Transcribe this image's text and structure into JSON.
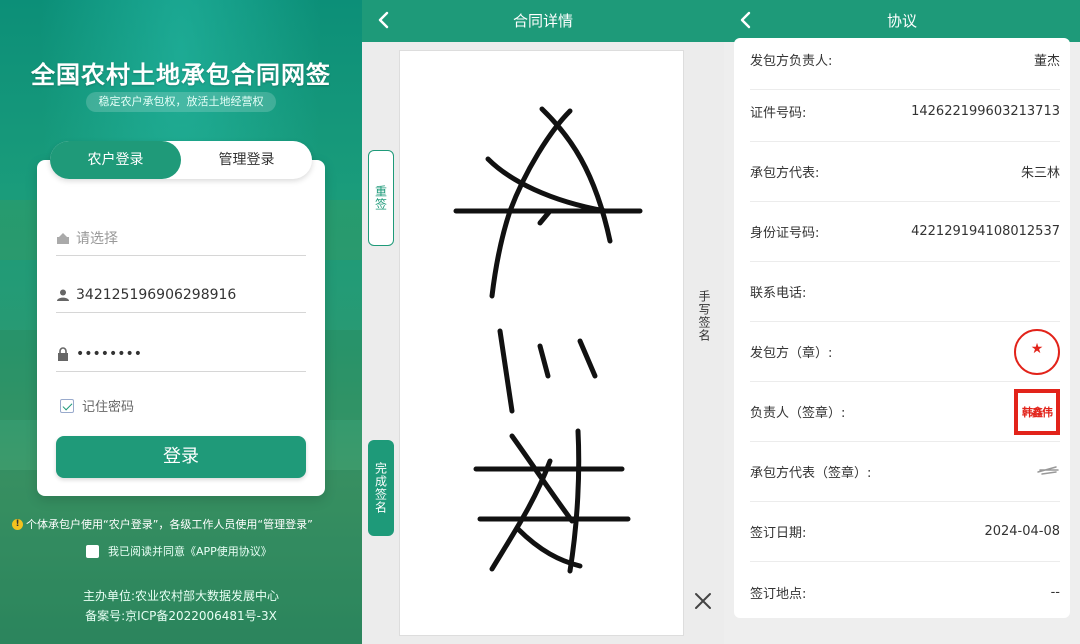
{
  "login": {
    "app_title": "全国农村土地承包合同网签",
    "slogan": "稳定农户承包权，放活土地经营权",
    "tabs": [
      "农户登录",
      "管理登录"
    ],
    "region_placeholder": "请选择",
    "account_value": "342125196906298916",
    "password_value": "••••••••",
    "remember_label": "记住密码",
    "login_button": "登录",
    "notice": "个体承包户使用“农户登录”，各级工作人员使用“管理登录”",
    "agreement_label": "我已阅读并同意《APP使用协议》",
    "sponsor": "主办单位:农业农村部大数据发展中心",
    "icp": "备案号:京ICP备2022006481号-3X"
  },
  "detail": {
    "title": "合同详情",
    "resign_button": "重签",
    "finish_button": "完成签名",
    "handwrite_label": "手写签名"
  },
  "agreement": {
    "title": "协议",
    "rows": [
      {
        "label": "发包方负责人:",
        "value": "董杰"
      },
      {
        "label": "证件号码:",
        "value": "142622199603213713"
      },
      {
        "label": "承包方代表:",
        "value": "朱三林"
      },
      {
        "label": "身份证号码:",
        "value": "422129194108012537"
      },
      {
        "label": "联系电话:",
        "value": ""
      },
      {
        "label": "发包方（章）:",
        "value": ""
      },
      {
        "label": "负责人（签章）:",
        "value": "韩鑫伟"
      },
      {
        "label": "承包方代表（签章）:",
        "value": ""
      },
      {
        "label": "签订日期:",
        "value": "2024-04-08"
      },
      {
        "label": "签订地点:",
        "value": "--"
      }
    ]
  },
  "colors": {
    "brand_green": "#1f9a79",
    "seal_red": "#e2231a"
  }
}
